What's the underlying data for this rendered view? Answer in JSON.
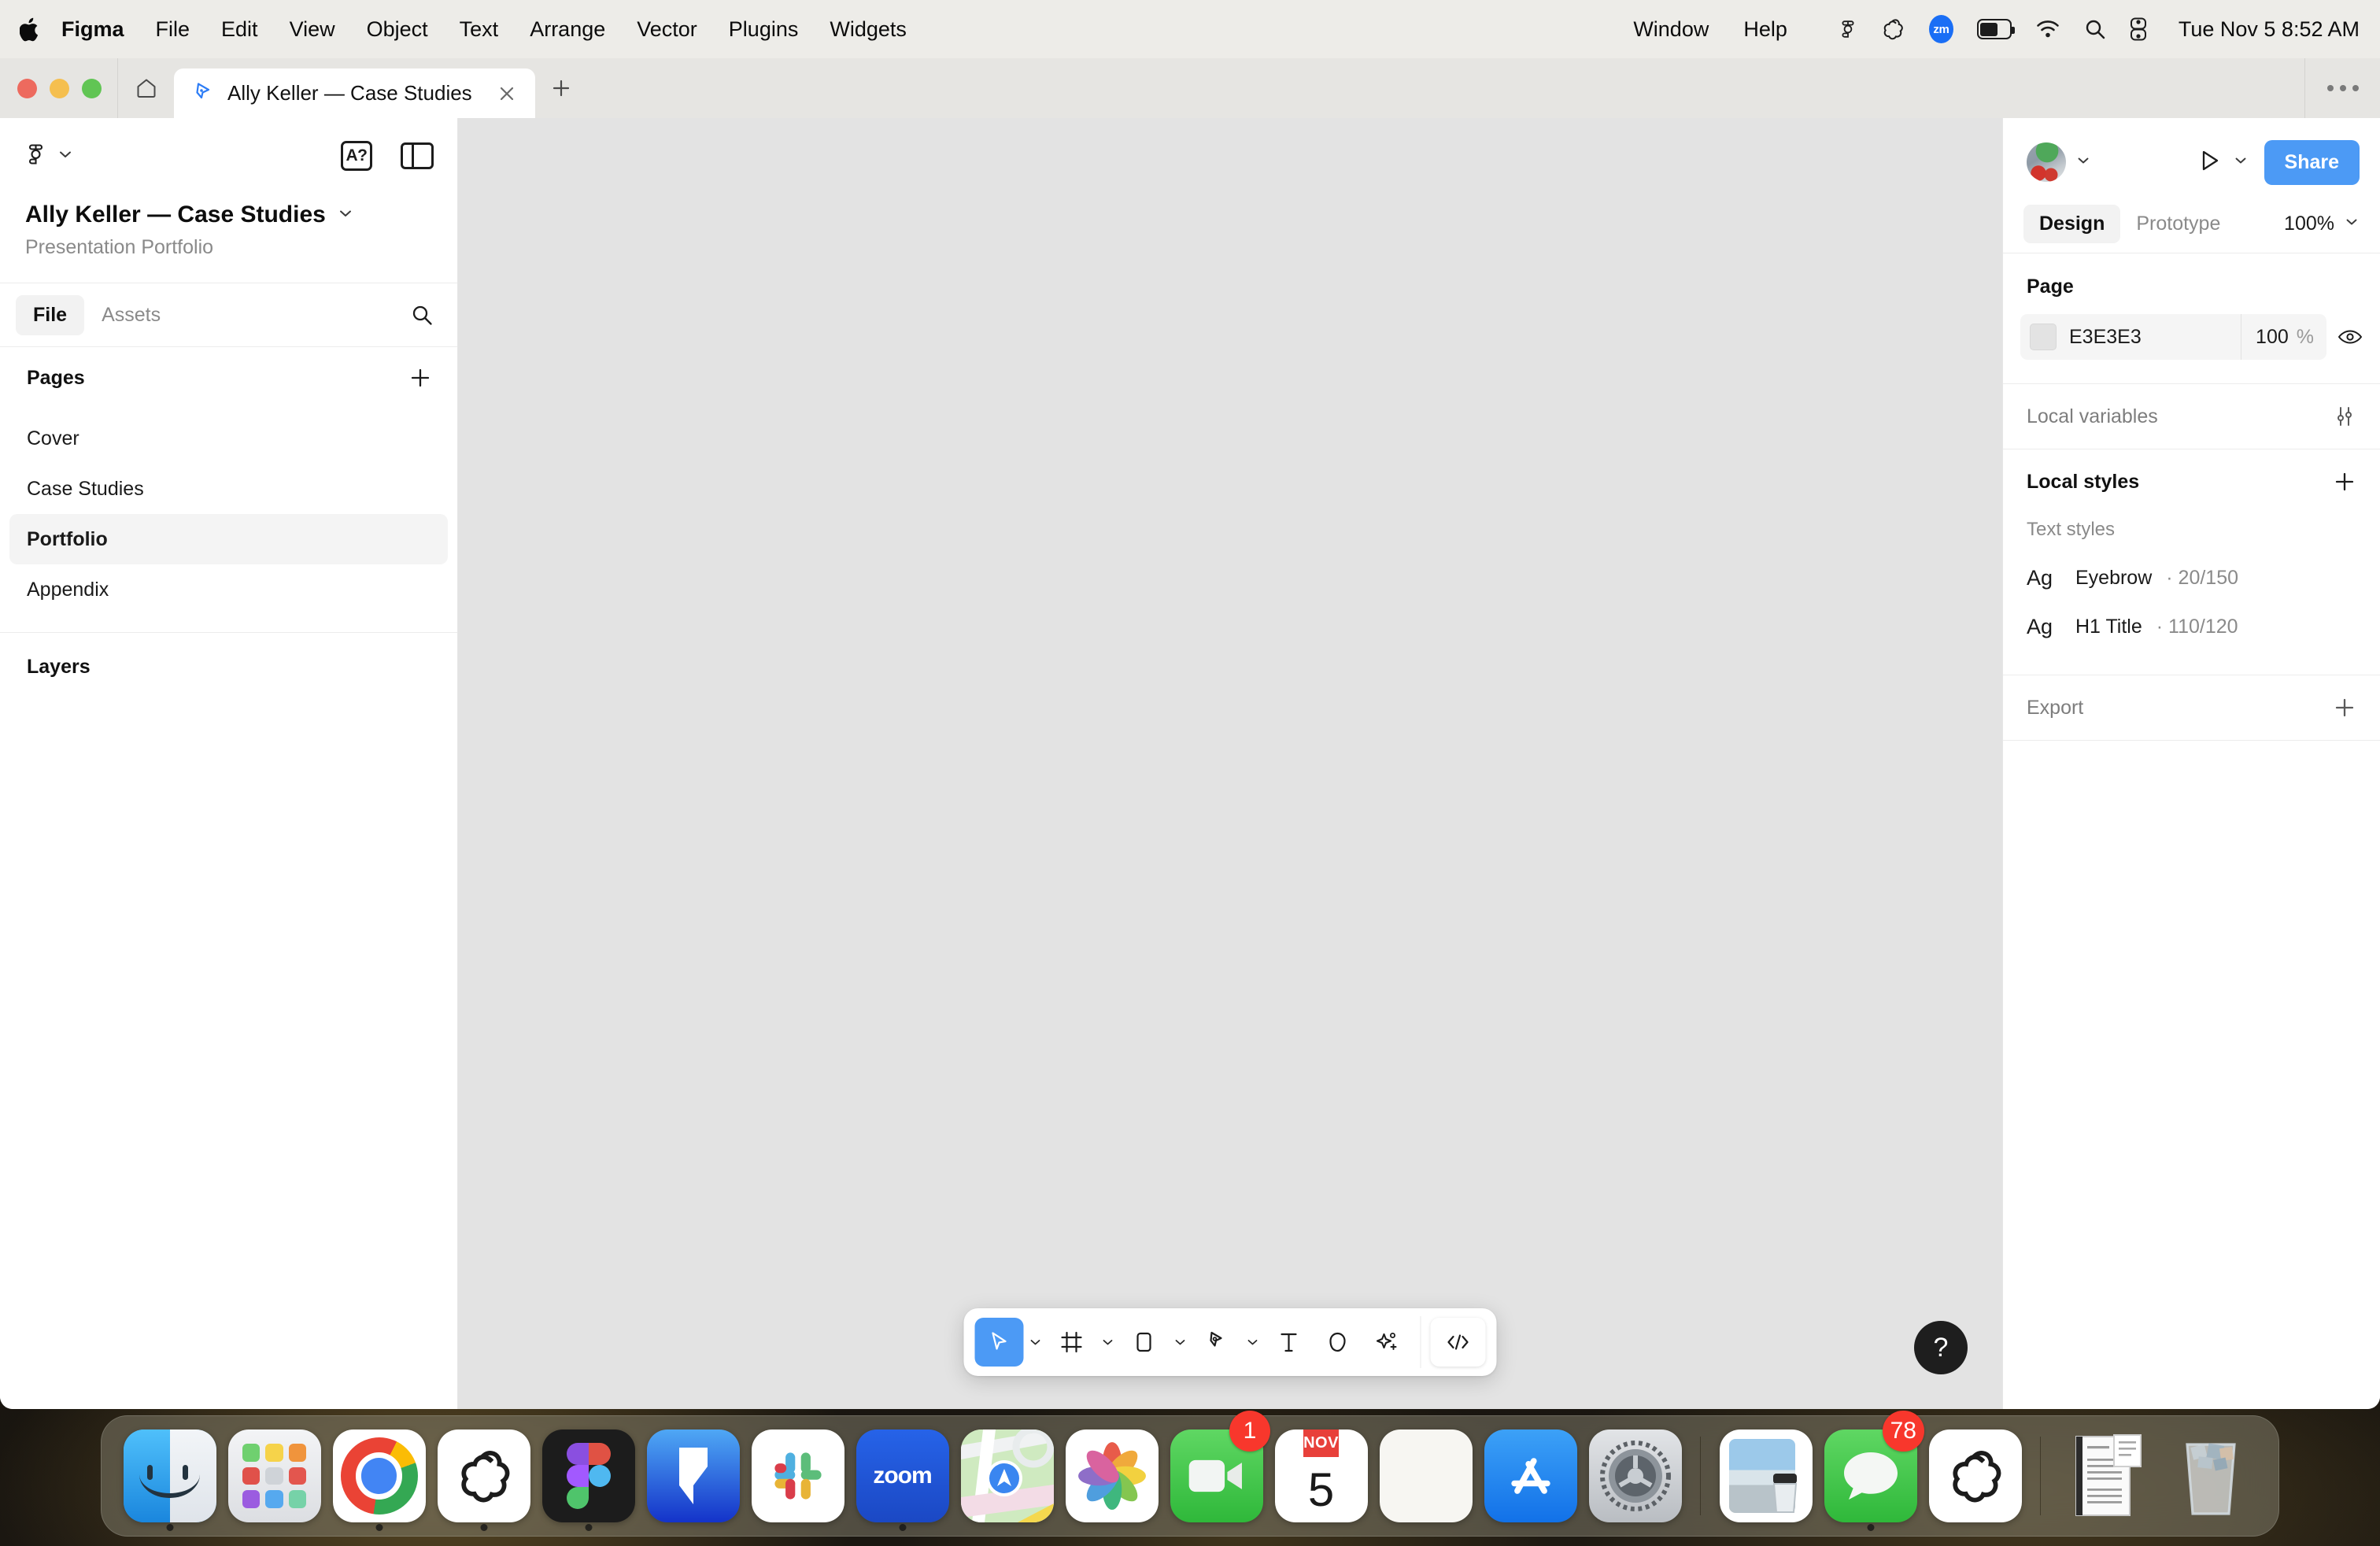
{
  "menubar": {
    "apple_icon": "apple-logo",
    "items": [
      "Figma",
      "File",
      "Edit",
      "View",
      "Object",
      "Text",
      "Arrange",
      "Vector",
      "Plugins",
      "Widgets"
    ],
    "right_items": [
      "Window",
      "Help"
    ],
    "tray": [
      "figma-menu-icon",
      "openai-menu-icon",
      "zoom-menu-icon",
      "battery-icon",
      "wifi-icon",
      "spotlight-search-icon",
      "control-center-icon"
    ],
    "zoom_label": "zm",
    "clock": "Tue Nov 5  8:52 AM"
  },
  "window": {
    "tab_title": "Ally Keller — Case Studies",
    "tab_icon": "figma-pen-icon",
    "home_icon": "home-icon",
    "close_icon": "close-icon",
    "new_tab_icon": "plus-icon",
    "more_icon": "ellipsis-icon"
  },
  "sidebar": {
    "logo_icon": "figma-logo-icon",
    "logo_caret": "chevron-down-icon",
    "font_help_label": "A?",
    "panel_toggle_icon": "panel-toggle-icon",
    "file_name": "Ally Keller — Case Studies",
    "file_name_caret": "chevron-down-icon",
    "file_subtitle": "Presentation Portfolio",
    "tabs": [
      {
        "label": "File",
        "active": true
      },
      {
        "label": "Assets",
        "active": false
      }
    ],
    "search_icon": "search-icon",
    "pages_title": "Pages",
    "pages_add_icon": "plus-icon",
    "pages": [
      {
        "label": "Cover",
        "active": false
      },
      {
        "label": "Case Studies",
        "active": false
      },
      {
        "label": "Portfolio",
        "active": true
      },
      {
        "label": "Appendix",
        "active": false
      }
    ],
    "layers_title": "Layers"
  },
  "canvas": {
    "background": "#E3E3E3"
  },
  "right_panel": {
    "avatar_caret": "chevron-down-icon",
    "present_icon": "play-icon",
    "present_caret": "chevron-down-icon",
    "share_label": "Share",
    "tabs": [
      {
        "label": "Design",
        "active": true
      },
      {
        "label": "Prototype",
        "active": false
      }
    ],
    "zoom_value": "100%",
    "zoom_caret": "chevron-down-icon",
    "page_section": {
      "title": "Page",
      "fill_hex": "E3E3E3",
      "fill_swatch_color": "#E3E3E3",
      "opacity": "100",
      "opacity_unit": "%",
      "visibility_icon": "eye-icon"
    },
    "local_variables": {
      "label": "Local variables",
      "action_icon": "variables-sliders-icon"
    },
    "local_styles": {
      "label": "Local styles",
      "add_icon": "plus-icon",
      "subheading": "Text styles",
      "styles": [
        {
          "preview": "Ag",
          "name": "Eyebrow",
          "meta": "· 20/150"
        },
        {
          "preview": "Ag",
          "name": "H1 Title",
          "meta": "· 110/120"
        }
      ]
    },
    "export": {
      "label": "Export",
      "add_icon": "plus-icon"
    }
  },
  "toolbar": {
    "tools": [
      {
        "name": "move-tool",
        "icon": "cursor-icon",
        "selected": true,
        "caret": true
      },
      {
        "name": "frame-tool",
        "icon": "frame-icon",
        "selected": false,
        "caret": true
      },
      {
        "name": "shape-tool",
        "icon": "rectangle-icon",
        "selected": false,
        "caret": true
      },
      {
        "name": "pen-tool",
        "icon": "pen-icon",
        "selected": false,
        "caret": true
      },
      {
        "name": "text-tool",
        "icon": "text-t-icon",
        "selected": false,
        "caret": false
      },
      {
        "name": "comment-tool",
        "icon": "comment-bubble-icon",
        "selected": false,
        "caret": false
      },
      {
        "name": "actions-tool",
        "icon": "sparkle-plus-icon",
        "selected": false,
        "caret": false
      }
    ],
    "dev_mode_icon": "code-brackets-icon"
  },
  "help_button": {
    "label": "?",
    "icon": "question-mark-icon"
  },
  "dock": {
    "items": [
      {
        "name": "finder",
        "icon": "finder-icon",
        "running": true,
        "badge": null
      },
      {
        "name": "launchpad",
        "icon": "launchpad-icon",
        "running": false,
        "badge": null
      },
      {
        "name": "chrome",
        "icon": "google-chrome-icon",
        "running": true,
        "badge": null
      },
      {
        "name": "chatgpt",
        "icon": "openai-icon",
        "running": true,
        "badge": null
      },
      {
        "name": "figma",
        "icon": "figma-icon",
        "running": true,
        "badge": null
      },
      {
        "name": "framer",
        "icon": "framer-icon",
        "running": false,
        "badge": null
      },
      {
        "name": "slack",
        "icon": "slack-icon",
        "running": false,
        "badge": null
      },
      {
        "name": "zoom",
        "icon": "zoom-icon",
        "running": true,
        "badge": null,
        "label": "zoom"
      },
      {
        "name": "maps",
        "icon": "apple-maps-icon",
        "running": false,
        "badge": null
      },
      {
        "name": "photos",
        "icon": "apple-photos-icon",
        "running": false,
        "badge": null
      },
      {
        "name": "facetime",
        "icon": "facetime-icon",
        "running": false,
        "badge": "1"
      },
      {
        "name": "calendar",
        "icon": "calendar-icon",
        "running": false,
        "badge": null,
        "month": "NOV",
        "day": "5"
      },
      {
        "name": "notes",
        "icon": "notes-icon",
        "running": false,
        "badge": null
      },
      {
        "name": "app-store",
        "icon": "app-store-icon",
        "running": false,
        "badge": null
      },
      {
        "name": "system-settings",
        "icon": "system-settings-gear-icon",
        "running": false,
        "badge": null
      },
      {
        "name": "preview",
        "icon": "preview-icon",
        "running": false,
        "badge": null
      },
      {
        "name": "messages",
        "icon": "messages-icon",
        "running": true,
        "badge": "78"
      },
      {
        "name": "chatgpt-2",
        "icon": "openai-icon",
        "running": false,
        "badge": null
      },
      {
        "name": "documents-stack",
        "icon": "documents-stack-icon",
        "running": false,
        "badge": null
      },
      {
        "name": "trash",
        "icon": "trash-icon",
        "running": false,
        "badge": null
      }
    ]
  }
}
